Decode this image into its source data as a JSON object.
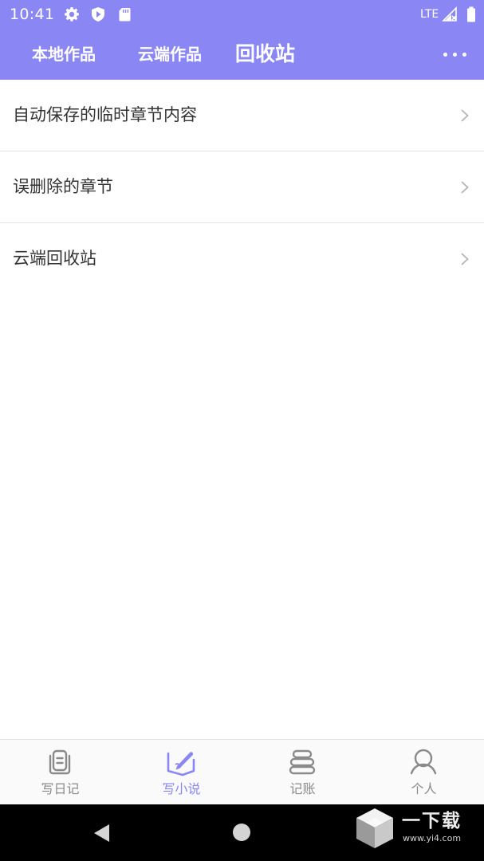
{
  "status_bar": {
    "time": "10:41",
    "network": "LTE",
    "icons": [
      "settings-icon",
      "shield-icon",
      "sd-card-icon",
      "signal-icon",
      "battery-icon"
    ]
  },
  "tabs": [
    {
      "label": "本地作品",
      "active": false
    },
    {
      "label": "云端作品",
      "active": false
    },
    {
      "label": "回收站",
      "active": true
    }
  ],
  "recycle_list": [
    {
      "label": "自动保存的临时章节内容"
    },
    {
      "label": "误删除的章节"
    },
    {
      "label": "云端回收站"
    }
  ],
  "bottom_nav": [
    {
      "label": "写日记",
      "icon": "diary-icon",
      "active": false
    },
    {
      "label": "写小说",
      "icon": "write-novel-icon",
      "active": true
    },
    {
      "label": "记账",
      "icon": "ledger-icon",
      "active": false
    },
    {
      "label": "个人",
      "icon": "profile-icon",
      "active": false
    }
  ],
  "watermark": {
    "title": "一下载",
    "url": "www.yi4.com"
  },
  "colors": {
    "accent": "#8a87f5",
    "text": "#333333",
    "inactive": "#8a8a8a",
    "divider": "#e2e2e2"
  }
}
